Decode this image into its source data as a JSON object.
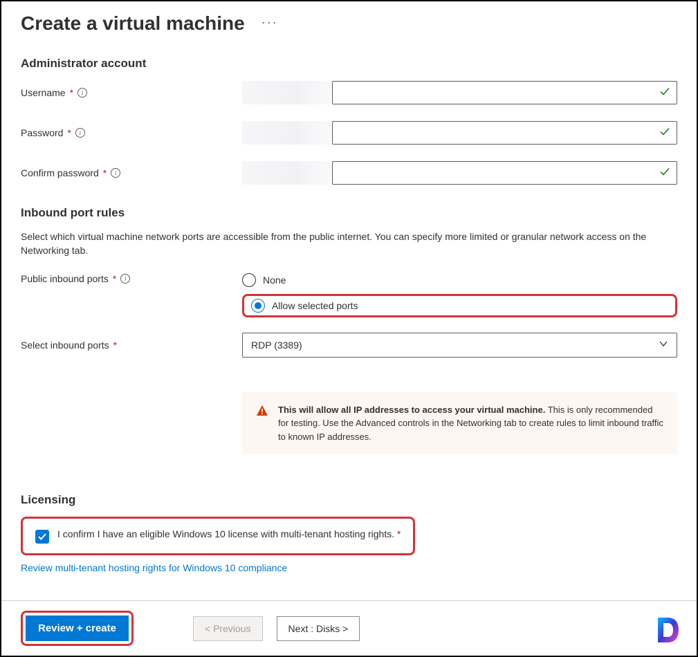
{
  "page": {
    "title": "Create a virtual machine"
  },
  "adminAccount": {
    "heading": "Administrator account",
    "usernameLabel": "Username",
    "passwordLabel": "Password",
    "confirmPasswordLabel": "Confirm password"
  },
  "inboundRules": {
    "heading": "Inbound port rules",
    "description": "Select which virtual machine network ports are accessible from the public internet. You can specify more limited or granular network access on the Networking tab.",
    "publicPortsLabel": "Public inbound ports",
    "options": {
      "none": "None",
      "allow": "Allow selected ports"
    },
    "selectPortsLabel": "Select inbound ports",
    "selectedPort": "RDP (3389)",
    "warning": {
      "bold": "This will allow all IP addresses to access your virtual machine.",
      "rest": "  This is only recommended for testing.  Use the Advanced controls in the Networking tab to create rules to limit inbound traffic to known IP addresses."
    }
  },
  "licensing": {
    "heading": "Licensing",
    "confirmText": "I confirm I have an eligible Windows 10 license with multi-tenant hosting rights.",
    "link": "Review multi-tenant hosting rights for Windows 10 compliance"
  },
  "footer": {
    "review": "Review + create",
    "previous": "< Previous",
    "next": "Next : Disks >"
  }
}
